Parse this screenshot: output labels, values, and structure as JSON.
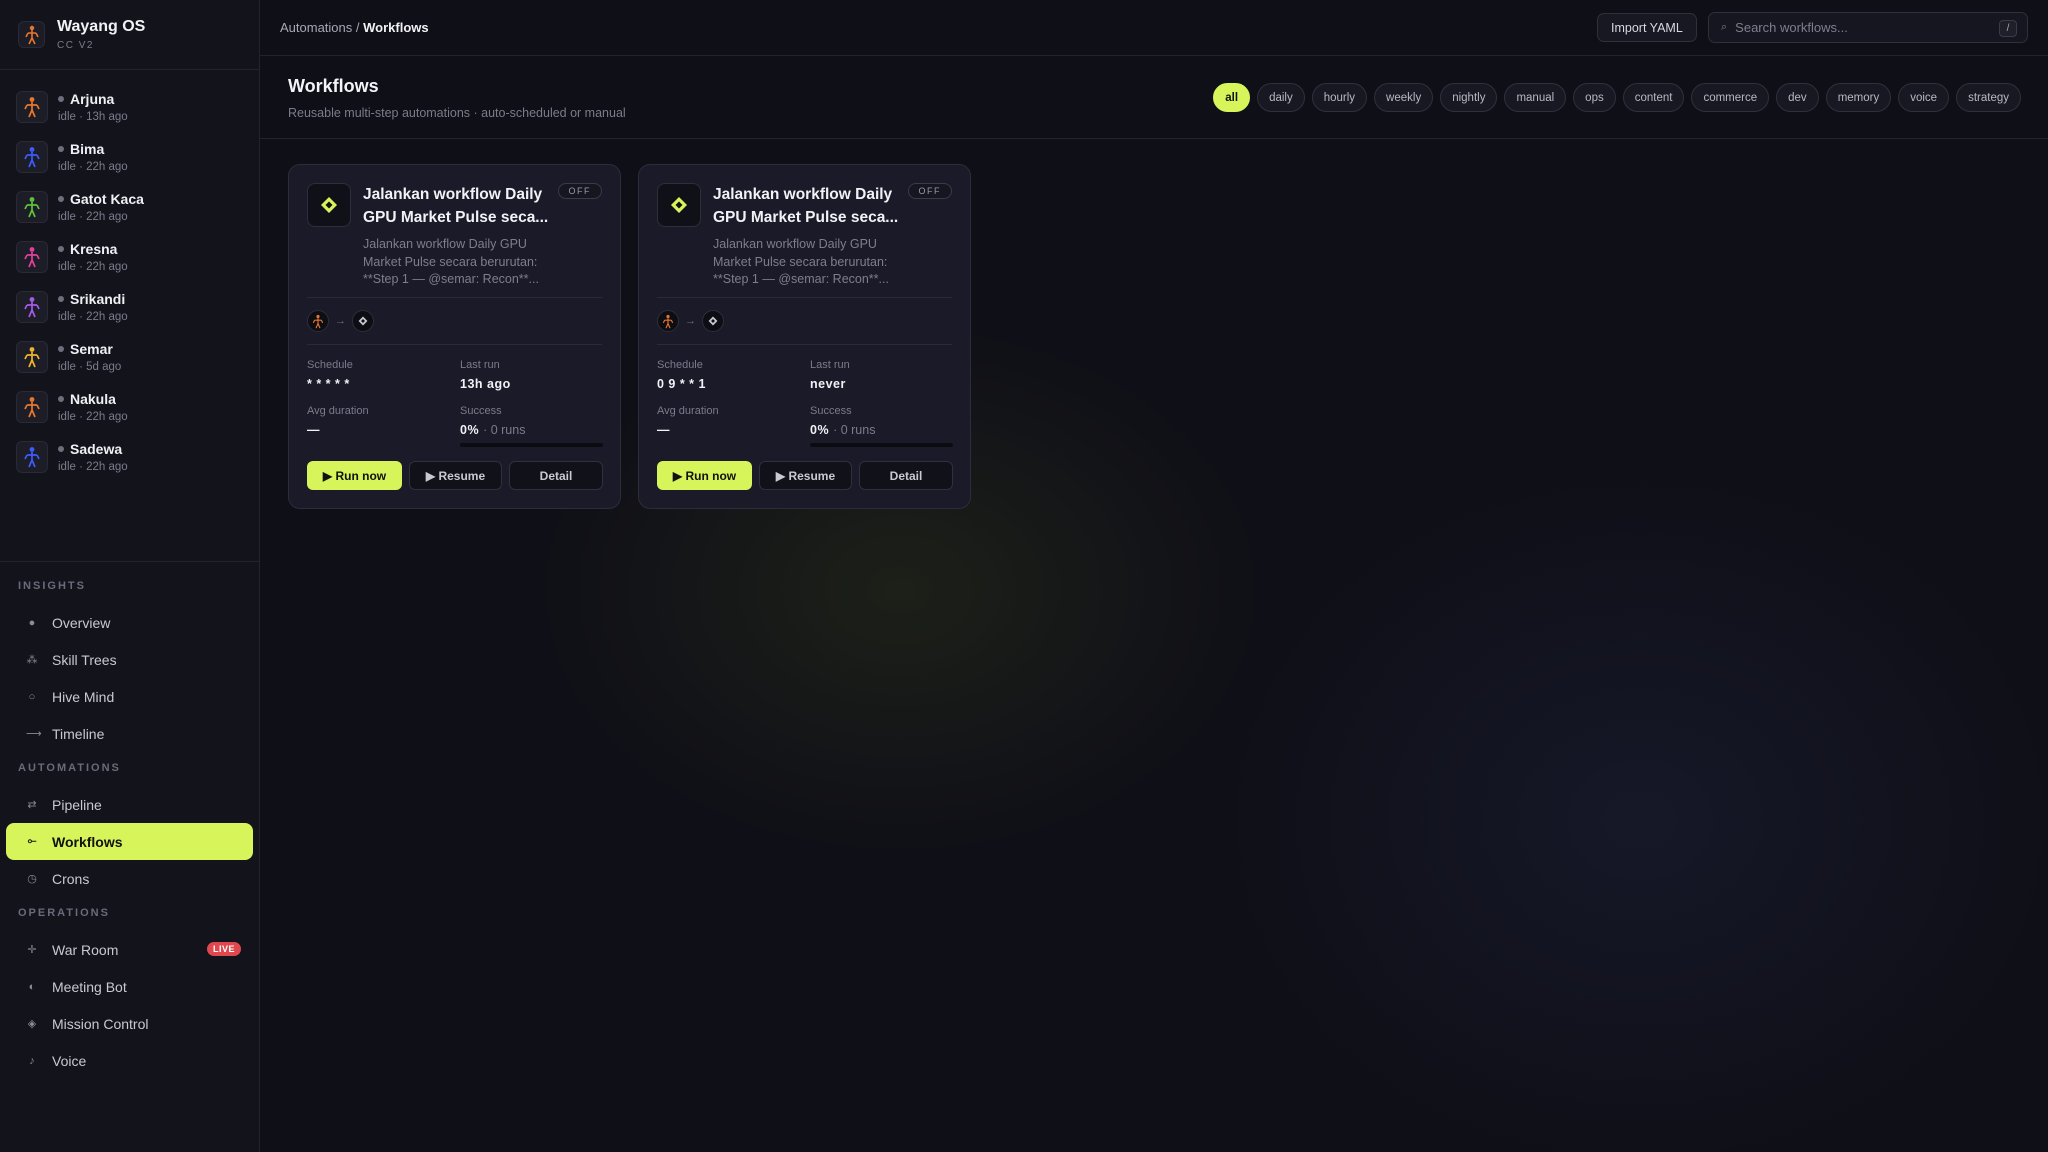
{
  "brand": {
    "title": "Wayang OS",
    "subtitle": "CC V2"
  },
  "agents": [
    {
      "name": "Arjuna",
      "status": "idle · 13h ago",
      "color": "#e8772e"
    },
    {
      "name": "Bima",
      "status": "idle · 22h ago",
      "color": "#3b5bff"
    },
    {
      "name": "Gatot Kaca",
      "status": "idle · 22h ago",
      "color": "#5ec23a"
    },
    {
      "name": "Kresna",
      "status": "idle · 22h ago",
      "color": "#e0409a"
    },
    {
      "name": "Srikandi",
      "status": "idle · 22h ago",
      "color": "#a45be8"
    },
    {
      "name": "Semar",
      "status": "idle · 5d ago",
      "color": "#f0b429"
    },
    {
      "name": "Nakula",
      "status": "idle · 22h ago",
      "color": "#e8772e"
    },
    {
      "name": "Sadewa",
      "status": "idle · 22h ago",
      "color": "#3b5bff"
    }
  ],
  "nav": {
    "insights_label": "INSIGHTS",
    "insights": [
      {
        "label": "Overview",
        "icon": "●"
      },
      {
        "label": "Skill Trees",
        "icon": "⁂"
      },
      {
        "label": "Hive Mind",
        "icon": "○"
      },
      {
        "label": "Timeline",
        "icon": "⟶"
      }
    ],
    "automations_label": "AUTOMATIONS",
    "automations": [
      {
        "label": "Pipeline",
        "icon": "⇄"
      },
      {
        "label": "Workflows",
        "icon": "⟜"
      },
      {
        "label": "Crons",
        "icon": "◷"
      }
    ],
    "operations_label": "OPERATIONS",
    "operations": [
      {
        "label": "War Room",
        "icon": "✛",
        "badge": "LIVE"
      },
      {
        "label": "Meeting Bot",
        "icon": "◐"
      },
      {
        "label": "Mission Control",
        "icon": "◈"
      },
      {
        "label": "Voice",
        "icon": "♪"
      }
    ]
  },
  "topbar": {
    "breadcrumb_parent": "Automations / ",
    "breadcrumb_current": "Workflows",
    "import_label": "Import YAML",
    "search_placeholder": "Search workflows...",
    "search_shortcut": "/"
  },
  "header": {
    "title": "Workflows",
    "subtitle": "Reusable multi-step automations · auto-scheduled or manual",
    "filters": [
      "all",
      "daily",
      "hourly",
      "weekly",
      "nightly",
      "manual",
      "ops",
      "content",
      "commerce",
      "dev",
      "memory",
      "voice",
      "strategy"
    ],
    "active_filter": "all"
  },
  "workflows": [
    {
      "title": "Jalankan workflow Daily GPU Market Pulse seca...",
      "description": "Jalankan workflow Daily GPU Market Pulse secara berurutan: **Step 1 — @semar: Recon**...",
      "state": "OFF",
      "schedule_label": "Schedule",
      "schedule": "* * * * *",
      "last_run_label": "Last run",
      "last_run": "13h ago",
      "avg_duration_label": "Avg duration",
      "avg_duration": "—",
      "success_label": "Success",
      "success": "0%",
      "runs": "· 0 runs",
      "run_label": "▶ Run now",
      "resume_label": "▶ Resume",
      "detail_label": "Detail"
    },
    {
      "title": "Jalankan workflow Daily GPU Market Pulse seca...",
      "description": "Jalankan workflow Daily GPU Market Pulse secara berurutan: **Step 1 — @semar: Recon**...",
      "state": "OFF",
      "schedule_label": "Schedule",
      "schedule": "0 9 * * 1",
      "last_run_label": "Last run",
      "last_run": "never",
      "avg_duration_label": "Avg duration",
      "avg_duration": "—",
      "success_label": "Success",
      "success": "0%",
      "runs": "· 0 runs",
      "run_label": "▶ Run now",
      "resume_label": "▶ Resume",
      "detail_label": "Detail"
    }
  ],
  "colors": {
    "accent": "#d7f55a",
    "live": "#e0484f"
  }
}
